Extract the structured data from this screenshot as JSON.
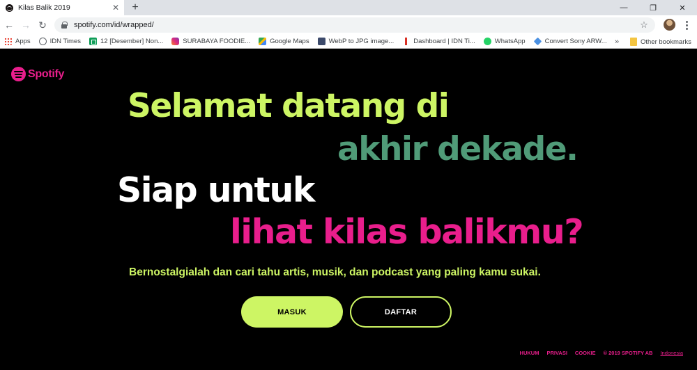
{
  "browser": {
    "tab_title": "Kilas Balik 2019",
    "tab_close": "✕",
    "new_tab": "+",
    "window_controls": [
      "—",
      "❐",
      "✕"
    ],
    "url": "spotify.com/id/wrapped/",
    "bookmarks": [
      {
        "label": "Apps",
        "icon": "apps-icon"
      },
      {
        "label": "IDN Times",
        "icon": "globe-icon"
      },
      {
        "label": "12 [Desember] Non...",
        "icon": "sheets-icon"
      },
      {
        "label": "SURABAYA FOODIE...",
        "icon": "instagram-icon"
      },
      {
        "label": "Google Maps",
        "icon": "maps-icon"
      },
      {
        "label": "WebP to JPG image...",
        "icon": "webp-icon"
      },
      {
        "label": "Dashboard | IDN Ti...",
        "icon": "dashboard-icon"
      },
      {
        "label": "WhatsApp",
        "icon": "whatsapp-icon"
      },
      {
        "label": "Convert Sony ARW...",
        "icon": "convert-icon"
      }
    ],
    "bookmarks_overflow": "»",
    "other_bookmarks": "Other bookmarks"
  },
  "page": {
    "logo_text": "Spotify",
    "headline": {
      "line1": "Selamat datang di",
      "line2": "akhir dekade.",
      "line3": "Siap untuk",
      "line4": "lihat kilas balikmu?"
    },
    "subline": "Bernostalgialah dan cari tahu artis, musik, dan podcast yang paling kamu sukai.",
    "buttons": {
      "login": "MASUK",
      "signup": "DAFTAR"
    },
    "footer": {
      "legal": "HUKUM",
      "privacy": "PRIVASI",
      "cookie": "COOKIE",
      "copyright": "© 2019 SPOTIFY AB",
      "language": "Indonesia"
    }
  },
  "colors": {
    "lime": "#cdf564",
    "green": "#509b78",
    "pink": "#e91e8c",
    "background": "#000000"
  }
}
